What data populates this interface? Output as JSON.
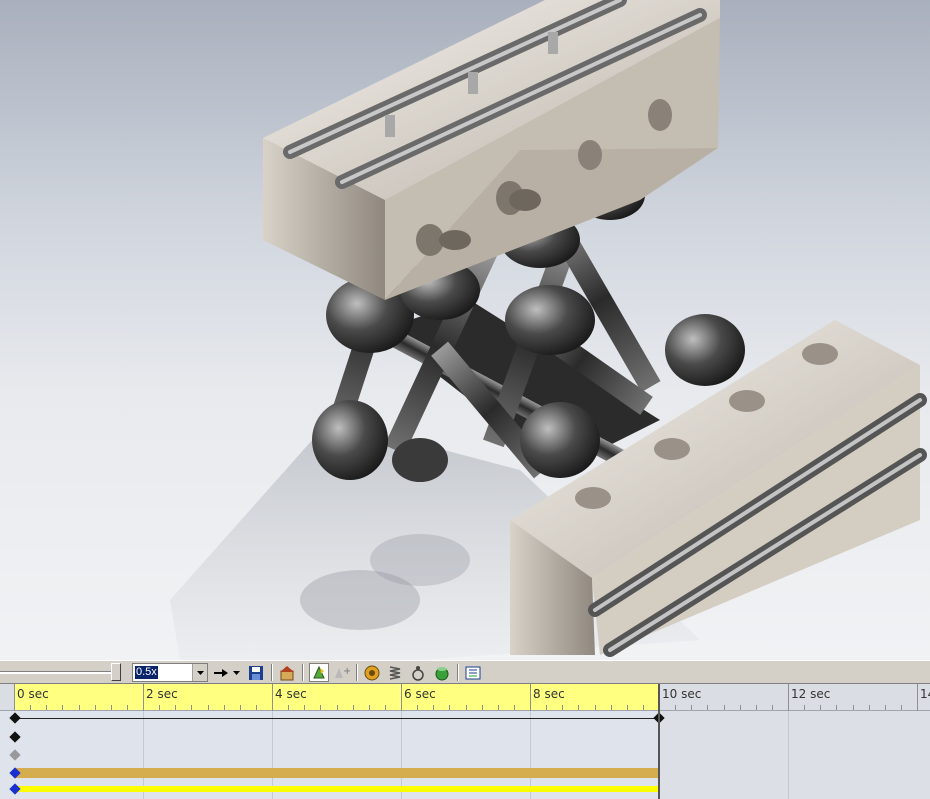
{
  "toolbar": {
    "playback_speed": "0.5x",
    "icons": [
      "play-arrow-icon",
      "dropdown-icon",
      "save-animation-icon",
      "home-position-icon",
      "autokey-icon",
      "add-key-icon",
      "motor-icon",
      "spring-icon",
      "contact-icon",
      "gravity-icon",
      "results-icon"
    ]
  },
  "timeline": {
    "ticks": [
      "0 sec",
      "2 sec",
      "4 sec",
      "6 sec",
      "8 sec",
      "10 sec",
      "12 sec",
      "14"
    ],
    "end_time": "10 sec"
  },
  "colors": {
    "key_row": "#222222",
    "orange_track": "#d6ad4e",
    "yellow_track": "#ffff00",
    "ruler_active": "#ffff80"
  }
}
